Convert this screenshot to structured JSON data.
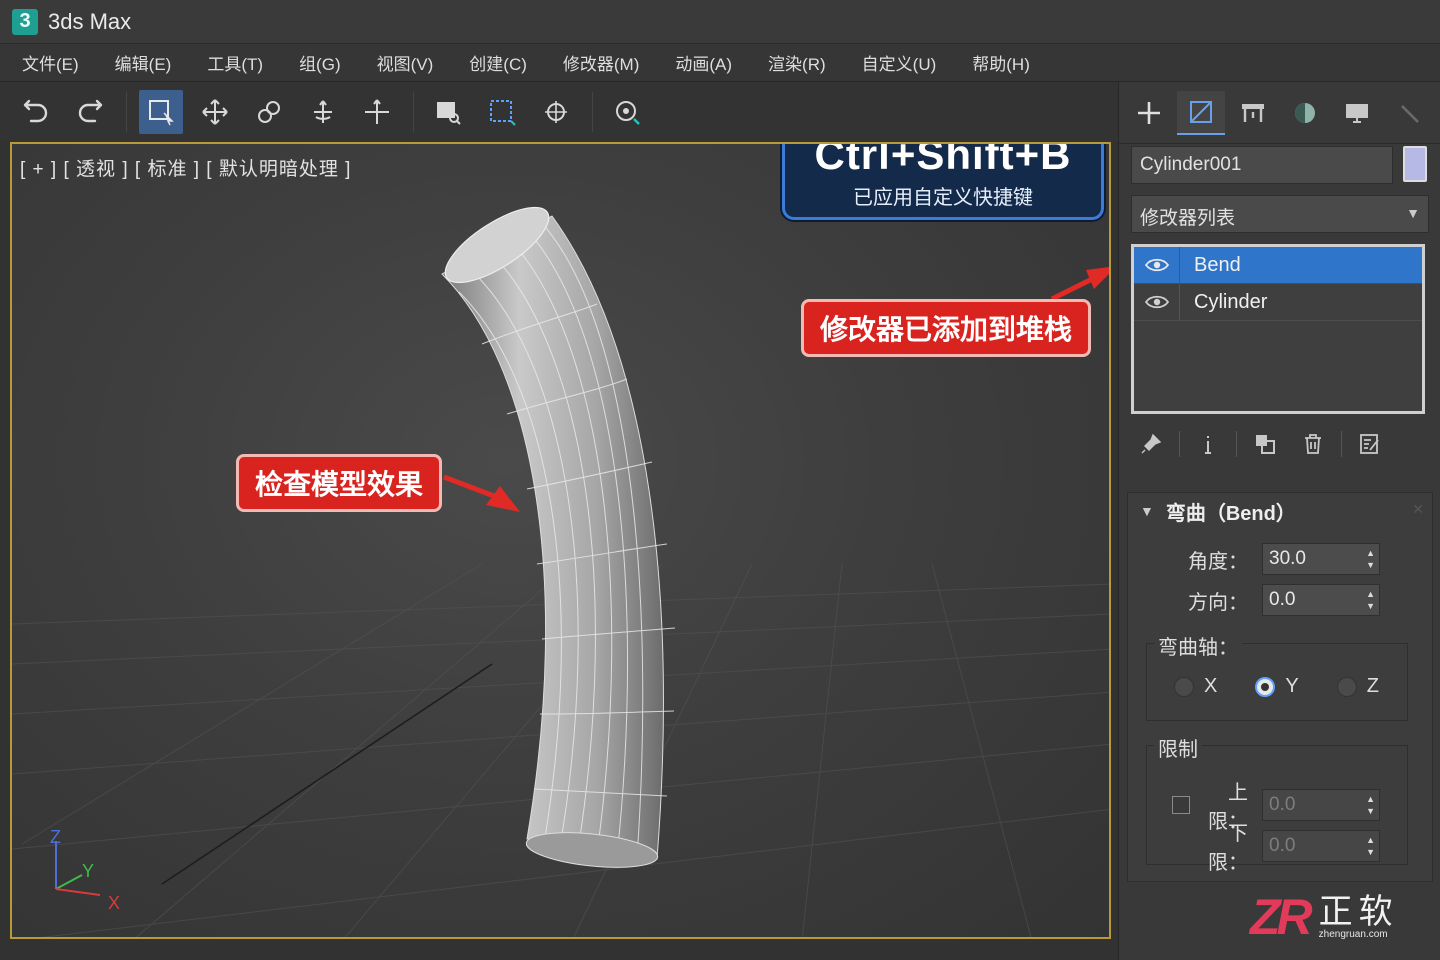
{
  "app": {
    "title": "3ds Max",
    "logo_letter": "3"
  },
  "menu": [
    "文件(E)",
    "编辑(E)",
    "工具(T)",
    "组(G)",
    "视图(V)",
    "创建(C)",
    "修改器(M)",
    "动画(A)",
    "渲染(R)",
    "自定义(U)",
    "帮助(H)"
  ],
  "viewport": {
    "label": "[ + ]  [ 透视 ]  [ 标准 ]  [ 默认明暗处理 ]",
    "shortcut_key": "Ctrl+Shift+B",
    "shortcut_note": "已应用自定义快捷键",
    "callout_check": "检查模型效果",
    "callout_modifier": "修改器已添加到堆栈",
    "axis": {
      "x": "X",
      "y": "Y",
      "z": "Z"
    }
  },
  "panel": {
    "object_name": "Cylinder001",
    "object_color": "#b6b8e6",
    "modifier_list": "修改器列表",
    "stack": [
      {
        "label": "Bend",
        "selected": true
      },
      {
        "label": "Cylinder",
        "selected": false
      }
    ],
    "rollout_title": "弯曲（Bend）",
    "angle_label": "角度：",
    "angle_value": "30.0",
    "direction_label": "方向：",
    "direction_value": "0.0",
    "bend_axis_label": "弯曲轴：",
    "axes": [
      {
        "label": "X",
        "checked": false
      },
      {
        "label": "Y",
        "checked": true
      },
      {
        "label": "Z",
        "checked": false
      }
    ],
    "limits_label": "限制",
    "upper_label": "上限：",
    "upper_value": "0.0",
    "lower_label": "下限：",
    "lower_value": "0.0"
  },
  "watermark": {
    "logo": "ZR",
    "name": "正软",
    "url": "zhengruan.com"
  },
  "colors": {
    "accent": "#2f75c9",
    "callout": "#d9231f",
    "viewport_border": "#b89a3a"
  }
}
